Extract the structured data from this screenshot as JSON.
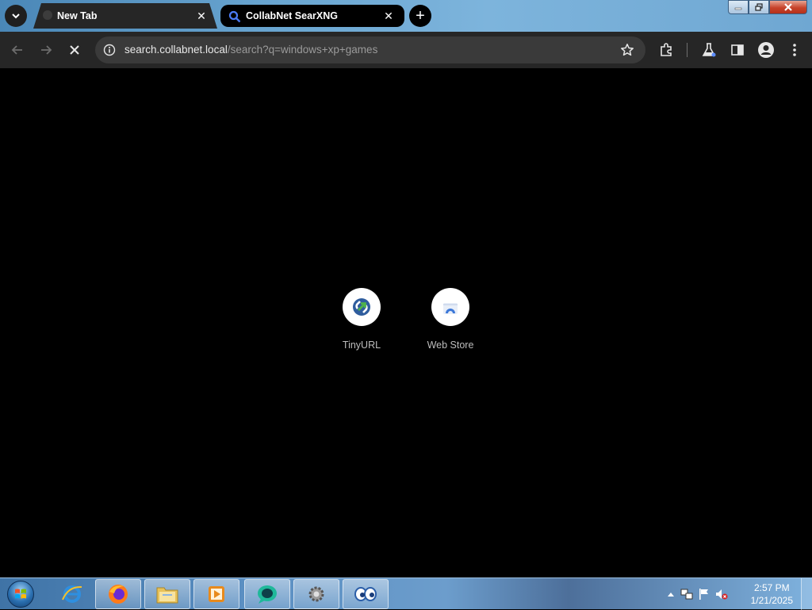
{
  "browser": {
    "tabs": [
      {
        "title": "New Tab",
        "active": false
      },
      {
        "title": "CollabNet SearXNG",
        "active": true
      }
    ],
    "address_bar": {
      "host": "search.collabnet.local",
      "path": "/search?q=windows+xp+games"
    },
    "status": "loading"
  },
  "new_tab_page": {
    "shortcuts": [
      {
        "label": "TinyURL",
        "icon": "tinyurl-icon"
      },
      {
        "label": "Web Store",
        "icon": "web-store-icon"
      }
    ]
  },
  "taskbar": {
    "pinned": [
      "internet-explorer-icon",
      "firefox-icon",
      "file-explorer-icon",
      "media-player-icon",
      "chat-app-icon",
      "settings-gear-icon",
      "eyes-app-icon"
    ],
    "clock": {
      "time": "2:57 PM",
      "date": "1/21/2025"
    }
  },
  "colors": {
    "tab_strip": "#6aa6d1",
    "toolbar": "#262626",
    "omnibox": "#3a3a3a",
    "content_background": "#000000"
  }
}
